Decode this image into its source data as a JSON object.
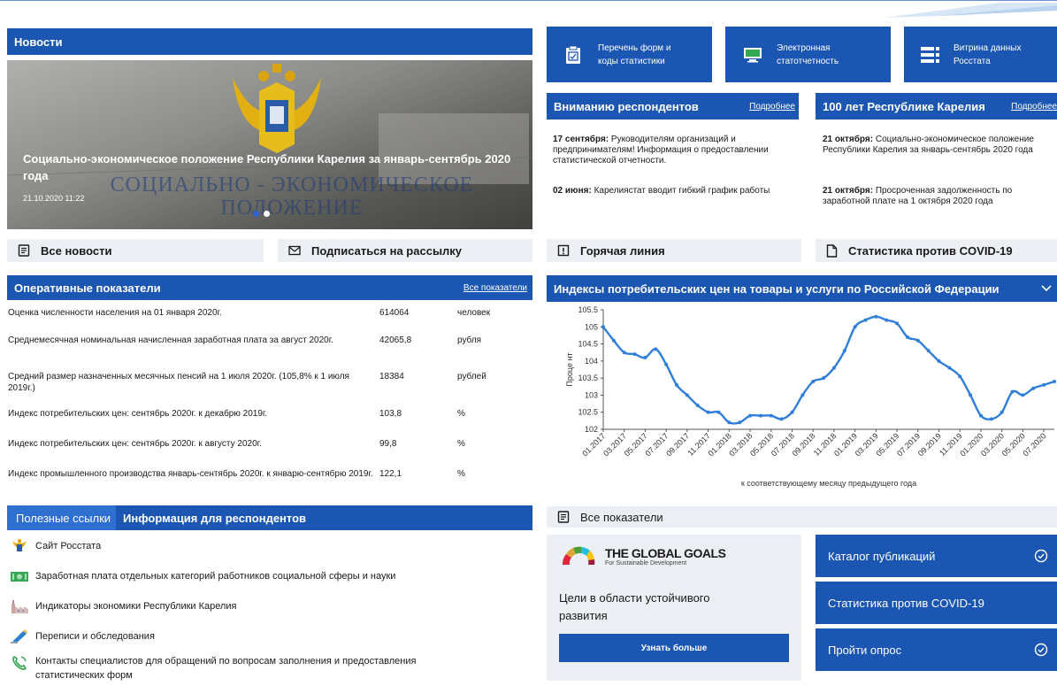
{
  "news": {
    "header": "Новости",
    "slide_caption": "Социально-экономическое положение Республики Карелия за январь-сентябрь 2020 года",
    "slide_date": "21.10.2020 11:22",
    "slide_bg_text_1": "СОЦИАЛЬНО - ЭКОНОМИЧЕСКОЕ",
    "slide_bg_text_2": "ПОЛОЖЕНИЕ",
    "all_news": "Все новости",
    "subscribe": "Подписаться на рассылку"
  },
  "top_links": [
    {
      "label_1": "Перечень форм и",
      "label_2": "коды статистики",
      "icon": "clipboard-icon"
    },
    {
      "label_1": "Электронная",
      "label_2": "статотчетность",
      "icon": "computer-icon"
    },
    {
      "label_1": "Витрина данных",
      "label_2": "Росстата",
      "icon": "data-showcase-icon"
    }
  ],
  "respondents": {
    "header": "Вниманию респондентов",
    "more": "Подробнее",
    "item1_date": "17 сентября:",
    "item1_text": " Руководителям организаций и предпринимателям! Информация о предоставлении статистической отчетности.",
    "item2_date": "02 июня:",
    "item2_text": " Карелиястат вводит гибкий график работы"
  },
  "karelia100": {
    "header": "100 лет Республике Карелия",
    "more": "Подробнее",
    "item1_date": "21 октября:",
    "item1_text": " Социально-экономическое положение Республики Карелия за январь-сентябрь 2020 года",
    "item2_date": "21 октября:",
    "item2_text": " Просроченная задолженность по заработной плате на 1 октября 2020 года"
  },
  "hotline": "Горячая линия",
  "covid_stats": "Статистика против COVID-19",
  "indicators": {
    "header": "Оперативные показатели",
    "all": "Все показатели",
    "rows": [
      {
        "name": "Оценка численности населения на 01 января 2020г.",
        "value": "614064",
        "unit": "человек"
      },
      {
        "name": "Среднемесячная номинальная начисленная заработная плата за август 2020г.",
        "value": "42065,8",
        "unit": "рубля"
      },
      {
        "name": "Средний размер назначенных месячных пенсий на 1 июля 2020г. (105,8% к 1 июля 2019г.)",
        "value": "18384",
        "unit": "рублей"
      },
      {
        "name": "Индекс потребительских цен: сентябрь 2020г. к декабрю 2019г.",
        "value": "103,8",
        "unit": "%"
      },
      {
        "name": "Индекс потребительских цен: сентябрь 2020г. к августу 2020г.",
        "value": "99,8",
        "unit": "%"
      },
      {
        "name": "Индекс промышленного производства январь-сентябрь 2020г. к январю-сентябрю 2019г.",
        "value": "122,1",
        "unit": "%"
      }
    ]
  },
  "tabs": {
    "useful": "Полезные ссылки",
    "respondents": "Информация для респондентов"
  },
  "useful_links": [
    {
      "label": "Сайт Росстата",
      "icon": "rosstat-emblem-icon"
    },
    {
      "label": "Заработная плата отдельных категорий работников социальной сферы и науки",
      "icon": "money-icon"
    },
    {
      "label": "Индикаторы экономики Республики Карелия",
      "icon": "factory-icon"
    },
    {
      "label": "Переписи и обследования",
      "icon": "pencil-icon"
    },
    {
      "label": "Контакты специалистов для обращений по вопросам заполнения и предоставления",
      "label2": "статистических форм",
      "icon": "phone-icon"
    }
  ],
  "chart_header": "Индексы потребительских цен на товары и услуги по Российской Федерации",
  "all_indicators": "Все показатели",
  "global_goals": {
    "logo_title": "THE GLOBAL GOALS",
    "logo_sub": "For Sustainable Development",
    "text": "Цели в области устойчивого развития",
    "button": "Узнать больше"
  },
  "right_buttons": [
    "Каталог публикаций",
    "Статистика против COVID-19",
    "Пройти опрос"
  ],
  "chart_data": {
    "type": "line",
    "ylabel": "Проце нт",
    "xlabel": "к соответствующему месяцу предыдущего года",
    "ylim": [
      102,
      105.5
    ],
    "yticks": [
      102,
      102.5,
      103,
      103.5,
      104,
      104.5,
      105,
      105.5
    ],
    "x": [
      "01.2017",
      "02.2017",
      "03.2017",
      "04.2017",
      "05.2017",
      "06.2017",
      "07.2017",
      "08.2017",
      "09.2017",
      "10.2017",
      "11.2017",
      "12.2017",
      "01.2018",
      "02.2018",
      "03.2018",
      "04.2018",
      "05.2018",
      "06.2018",
      "07.2018",
      "08.2018",
      "09.2018",
      "10.2018",
      "11.2018",
      "12.2018",
      "01.2019",
      "02.2019",
      "03.2019",
      "04.2019",
      "05.2019",
      "06.2019",
      "07.2019",
      "08.2019",
      "09.2019",
      "10.2019",
      "11.2019",
      "12.2019",
      "01.2020",
      "02.2020",
      "03.2020",
      "04.2020",
      "05.2020",
      "06.2020",
      "07.2020",
      "08.2020"
    ],
    "xticks": [
      "01.2017",
      "03.2017",
      "05.2017",
      "07.2017",
      "09.2017",
      "11.2017",
      "01.2018",
      "03.2018",
      "05.2018",
      "07.2018",
      "09.2018",
      "11.2018",
      "01.2019",
      "03.2019",
      "05.2019",
      "07.2019",
      "09.2019",
      "11.2019",
      "01.2020",
      "03.2020",
      "05.2020",
      "07.2020"
    ],
    "values": [
      105.0,
      104.6,
      104.25,
      104.2,
      104.1,
      104.35,
      103.9,
      103.3,
      103.0,
      102.7,
      102.5,
      102.5,
      102.2,
      102.2,
      102.4,
      102.4,
      102.4,
      102.3,
      102.5,
      103.0,
      103.4,
      103.5,
      103.8,
      104.3,
      105.0,
      105.2,
      105.3,
      105.2,
      105.1,
      104.7,
      104.6,
      104.3,
      104.0,
      103.8,
      103.55,
      103.0,
      102.4,
      102.3,
      102.5,
      103.1,
      103.0,
      103.2,
      103.3,
      103.4
    ]
  }
}
